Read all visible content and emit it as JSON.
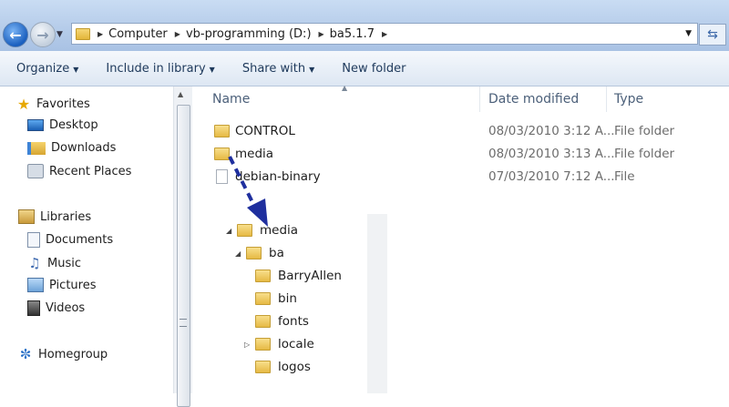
{
  "address": {
    "segments": [
      "Computer",
      "vb-programming (D:)",
      "ba5.1.7"
    ]
  },
  "toolbar": {
    "organize": "Organize",
    "include": "Include in library",
    "share": "Share with",
    "new_folder": "New folder"
  },
  "sidebar": {
    "favorites": {
      "title": "Favorites",
      "items": [
        "Desktop",
        "Downloads",
        "Recent Places"
      ]
    },
    "libraries": {
      "title": "Libraries",
      "items": [
        "Documents",
        "Music",
        "Pictures",
        "Videos"
      ]
    },
    "homegroup": "Homegroup"
  },
  "columns": {
    "name": "Name",
    "date": "Date modified",
    "type": "Type"
  },
  "files": [
    {
      "name": "CONTROL",
      "date": "08/03/2010 3:12 A...",
      "type": "File folder",
      "icon": "folder-icon"
    },
    {
      "name": "media",
      "date": "08/03/2010 3:13 A...",
      "type": "File folder",
      "icon": "folder-icon"
    },
    {
      "name": "debian-binary",
      "date": "07/03/2010 7:12 A...",
      "type": "File",
      "icon": "file-icon"
    }
  ],
  "tree": {
    "root": "media",
    "child": "ba",
    "items": [
      "BarryAllen",
      "bin",
      "fonts",
      "locale",
      "logos"
    ]
  },
  "colors": {
    "annotation_arrow": "#1f2f9e"
  }
}
